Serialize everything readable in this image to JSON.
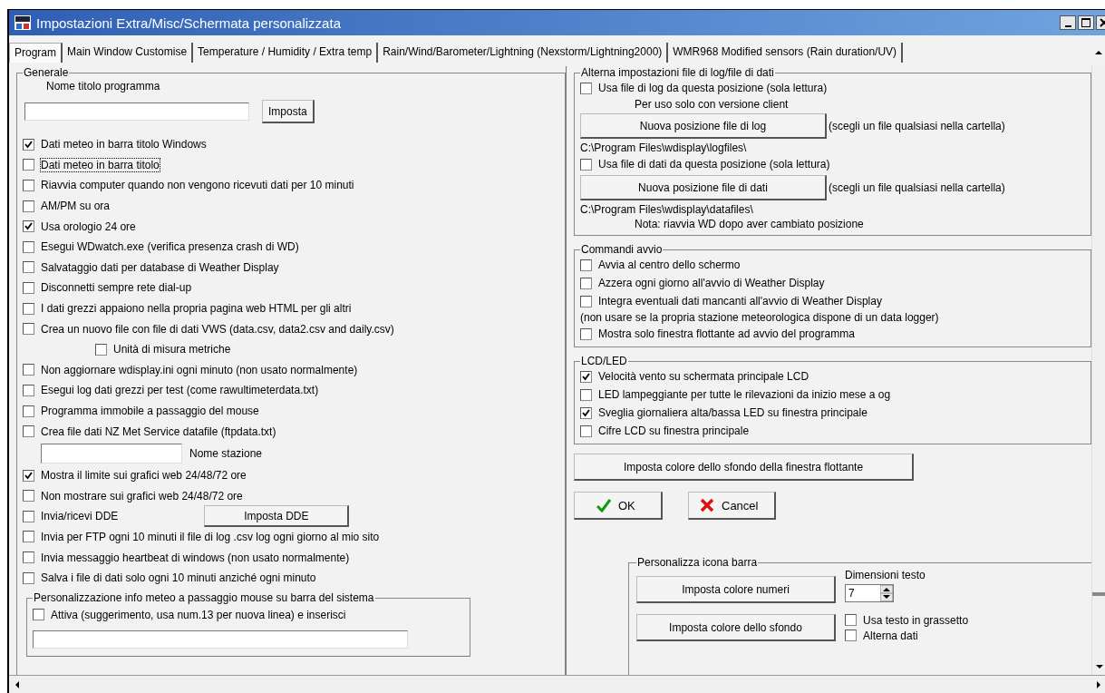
{
  "window": {
    "title": "Impostazioni Extra/Misc/Schermata personalizzata"
  },
  "tabs": [
    {
      "label": "Program",
      "selected": true
    },
    {
      "label": "Main Window Customise",
      "selected": false
    },
    {
      "label": "Temperature / Humidity / Extra temp",
      "selected": false
    },
    {
      "label": "Rain/Wind/Barometer/Lightning (Nexstorm/Lightning2000)",
      "selected": false
    },
    {
      "label": "WMR968 Modified sensors (Rain duration/UV)",
      "selected": false
    }
  ],
  "general": {
    "title": "Generale",
    "name_label": "Nome titolo programma",
    "set_button": "Imposta",
    "items": [
      {
        "kind": "checkbox",
        "label": "Dati meteo in barra titolo Windows",
        "checked": true,
        "focused": false
      },
      {
        "kind": "checkbox",
        "label": "Dati meteo in barra titolo",
        "checked": false,
        "focused": true
      },
      {
        "kind": "checkbox",
        "label": "Riavvia computer quando non vengono ricevuti dati per 10 minuti",
        "checked": false,
        "focused": false
      },
      {
        "kind": "checkbox",
        "label": "AM/PM su ora",
        "checked": false,
        "focused": false
      },
      {
        "kind": "checkbox",
        "label": "Usa orologio 24 ore",
        "checked": true,
        "focused": false
      },
      {
        "kind": "checkbox",
        "label": "Esegui WDwatch.exe (verifica presenza crash di WD)",
        "checked": false,
        "focused": false
      },
      {
        "kind": "checkbox",
        "label": "Salvataggio dati per database di Weather Display",
        "checked": false,
        "focused": false
      },
      {
        "kind": "checkbox",
        "label": "Disconnetti sempre rete dial-up",
        "checked": false,
        "focused": false
      },
      {
        "kind": "checkbox",
        "label": "I dati grezzi appaiono nella propria pagina web HTML per gli altri",
        "checked": false,
        "focused": false
      },
      {
        "kind": "checkbox",
        "label": "Crea un nuovo file con file di dati VWS (data.csv, data2.csv and daily.csv)",
        "checked": false,
        "focused": false
      },
      {
        "kind": "subcheckbox",
        "label": "Unità di misura metriche",
        "checked": false,
        "focused": false
      },
      {
        "kind": "checkbox",
        "label": "Non aggiornare wdisplay.ini ogni minuto (non usato normalmente)",
        "checked": false,
        "focused": false
      },
      {
        "kind": "checkbox",
        "label": "Esegui log dati grezzi per test (come rawultimeterdata.txt)",
        "checked": false,
        "focused": false
      },
      {
        "kind": "checkbox",
        "label": "Programma immobile a passaggio del mouse",
        "checked": false,
        "focused": false
      },
      {
        "kind": "checkbox",
        "label": "Crea file dati NZ Met Service datafile (ftpdata.txt)",
        "checked": false,
        "focused": false
      },
      {
        "kind": "field",
        "label": "Nome stazione"
      },
      {
        "kind": "checkbox",
        "label": "Mostra il limite sui grafici web 24/48/72 ore",
        "checked": true,
        "focused": false
      },
      {
        "kind": "checkbox",
        "label": "Non mostrare sui grafici web 24/48/72 ore",
        "checked": false,
        "focused": false
      },
      {
        "kind": "checkbox",
        "label": "Invia/ricevi DDE",
        "checked": false,
        "focused": false,
        "button": "Imposta DDE"
      },
      {
        "kind": "checkbox",
        "label": "Invia per FTP ogni 10 minuti il file di log .csv log ogni giorno al mio sito",
        "checked": false,
        "focused": false
      },
      {
        "kind": "checkbox",
        "label": "Invia messaggio heartbeat di windows (non usato normalmente)",
        "checked": false,
        "focused": false
      },
      {
        "kind": "checkbox",
        "label": "Salva i file di dati solo ogni 10 minuti anziché ogni minuto",
        "checked": false,
        "focused": false
      }
    ]
  },
  "tooltip_group": {
    "title": "Personalizzazione info meteo a passaggio mouse su barra del sistema",
    "checkbox": {
      "label": "Attiva (suggerimento, usa num.13 per nuova linea) e inserisci",
      "checked": false
    }
  },
  "file_group": {
    "title": "Alterna impostazioni file di log/file di dati",
    "items": [
      {
        "kind": "checkbox",
        "label": "Usa file di log da questa posizione (sola lettura)",
        "checked": false
      },
      {
        "kind": "note",
        "text": "Per uso solo con versione client"
      },
      {
        "kind": "button",
        "label": "Nuova posizione file di log",
        "note": "(scegli un file qualsiasi nella cartella)"
      },
      {
        "kind": "path",
        "text": "C:\\Program Files\\wdisplay\\logfiles\\"
      },
      {
        "kind": "checkbox",
        "label": "Usa file di dati da questa posizione (sola lettura)",
        "checked": false
      },
      {
        "kind": "button",
        "label": "Nuova posizione file di dati",
        "note": "(scegli un file qualsiasi nella cartella)"
      },
      {
        "kind": "path",
        "text": "C:\\Program Files\\wdisplay\\datafiles\\"
      },
      {
        "kind": "note",
        "text": "Nota: riavvia WD dopo aver cambiato posizione"
      }
    ]
  },
  "startup_group": {
    "title": "Commandi avvio",
    "items": [
      {
        "kind": "checkbox",
        "label": "Avvia al centro dello schermo",
        "checked": false
      },
      {
        "kind": "checkbox",
        "label": "Azzera ogni giorno all'avvio di Weather Display",
        "checked": false
      },
      {
        "kind": "checkbox",
        "label": "Integra eventuali dati mancanti all'avvio di Weather Display",
        "checked": false
      },
      {
        "kind": "path",
        "text": "(non usare se la propria stazione meteorologica dispone di un data logger)"
      },
      {
        "kind": "checkbox",
        "label": "Mostra solo finestra flottante ad avvio del programma",
        "checked": false
      }
    ]
  },
  "lcd_group": {
    "title": "LCD/LED",
    "items": [
      {
        "kind": "checkbox",
        "label": "Velocità vento su schermata principale LCD",
        "checked": true
      },
      {
        "kind": "checkbox",
        "label": "LED lampeggiante per tutte le rilevazioni da inizio mese a og",
        "checked": false
      },
      {
        "kind": "checkbox",
        "label": "Sveglia giornaliera alta/bassa LED su finestra principale",
        "checked": true
      },
      {
        "kind": "checkbox",
        "label": "Cifre LCD su finestra principale",
        "checked": false
      }
    ]
  },
  "float_bg_button": "Imposta colore dello sfondo della finestra flottante",
  "ok_button": "OK",
  "cancel_button": "Cancel",
  "tray_group": {
    "title": "Personalizza icona barra",
    "buttons": [
      "Imposta colore numeri",
      "Imposta colore dello sfondo"
    ],
    "size_label": "Dimensioni testo",
    "size_value": "7",
    "checkboxes": [
      {
        "label": "Usa testo in grassetto",
        "checked": false
      },
      {
        "label": "Alterna dati",
        "checked": false
      }
    ]
  }
}
